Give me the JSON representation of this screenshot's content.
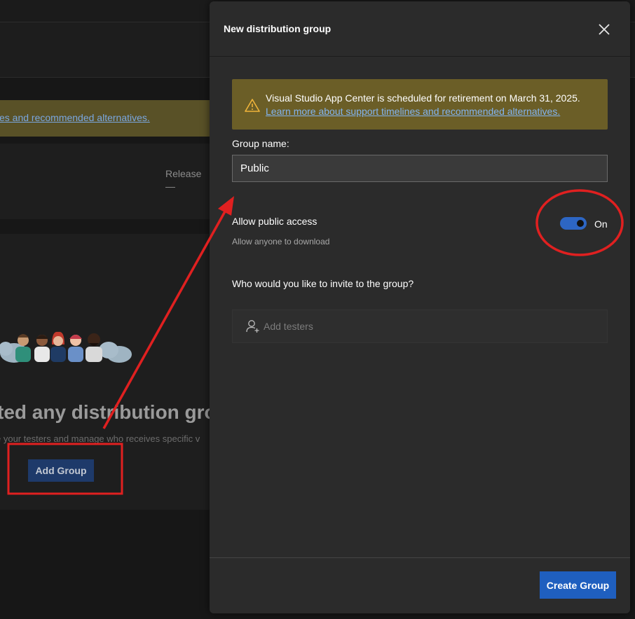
{
  "background": {
    "banner_link": "es and recommended alternatives.",
    "release_label": "Release",
    "release_value": "—",
    "empty_title": "ted any distribution gro",
    "empty_subtitle": "e your testers and manage who receives specific v",
    "add_group_label": "Add Group"
  },
  "panel": {
    "title": "New distribution group",
    "notice": {
      "text": "Visual Studio App Center is scheduled for retirement on March 31, 2025.",
      "link": "Learn more about support timelines and recommended alternatives.",
      "icon": "warning-icon"
    },
    "group_name": {
      "label": "Group name:",
      "value": "Public"
    },
    "public_access": {
      "label": "Allow public access",
      "description": "Allow anyone to download",
      "toggle_state": "On",
      "enabled": true
    },
    "invite": {
      "label": "Who would you like to invite to the group?",
      "placeholder": "Add testers",
      "icon": "add-user-icon"
    },
    "create_button": "Create Group"
  },
  "colors": {
    "accent": "#1f5fbf",
    "toggle_on": "#2d66c4",
    "notice_bg": "#6b5e27",
    "annotation_red": "#e02020"
  }
}
